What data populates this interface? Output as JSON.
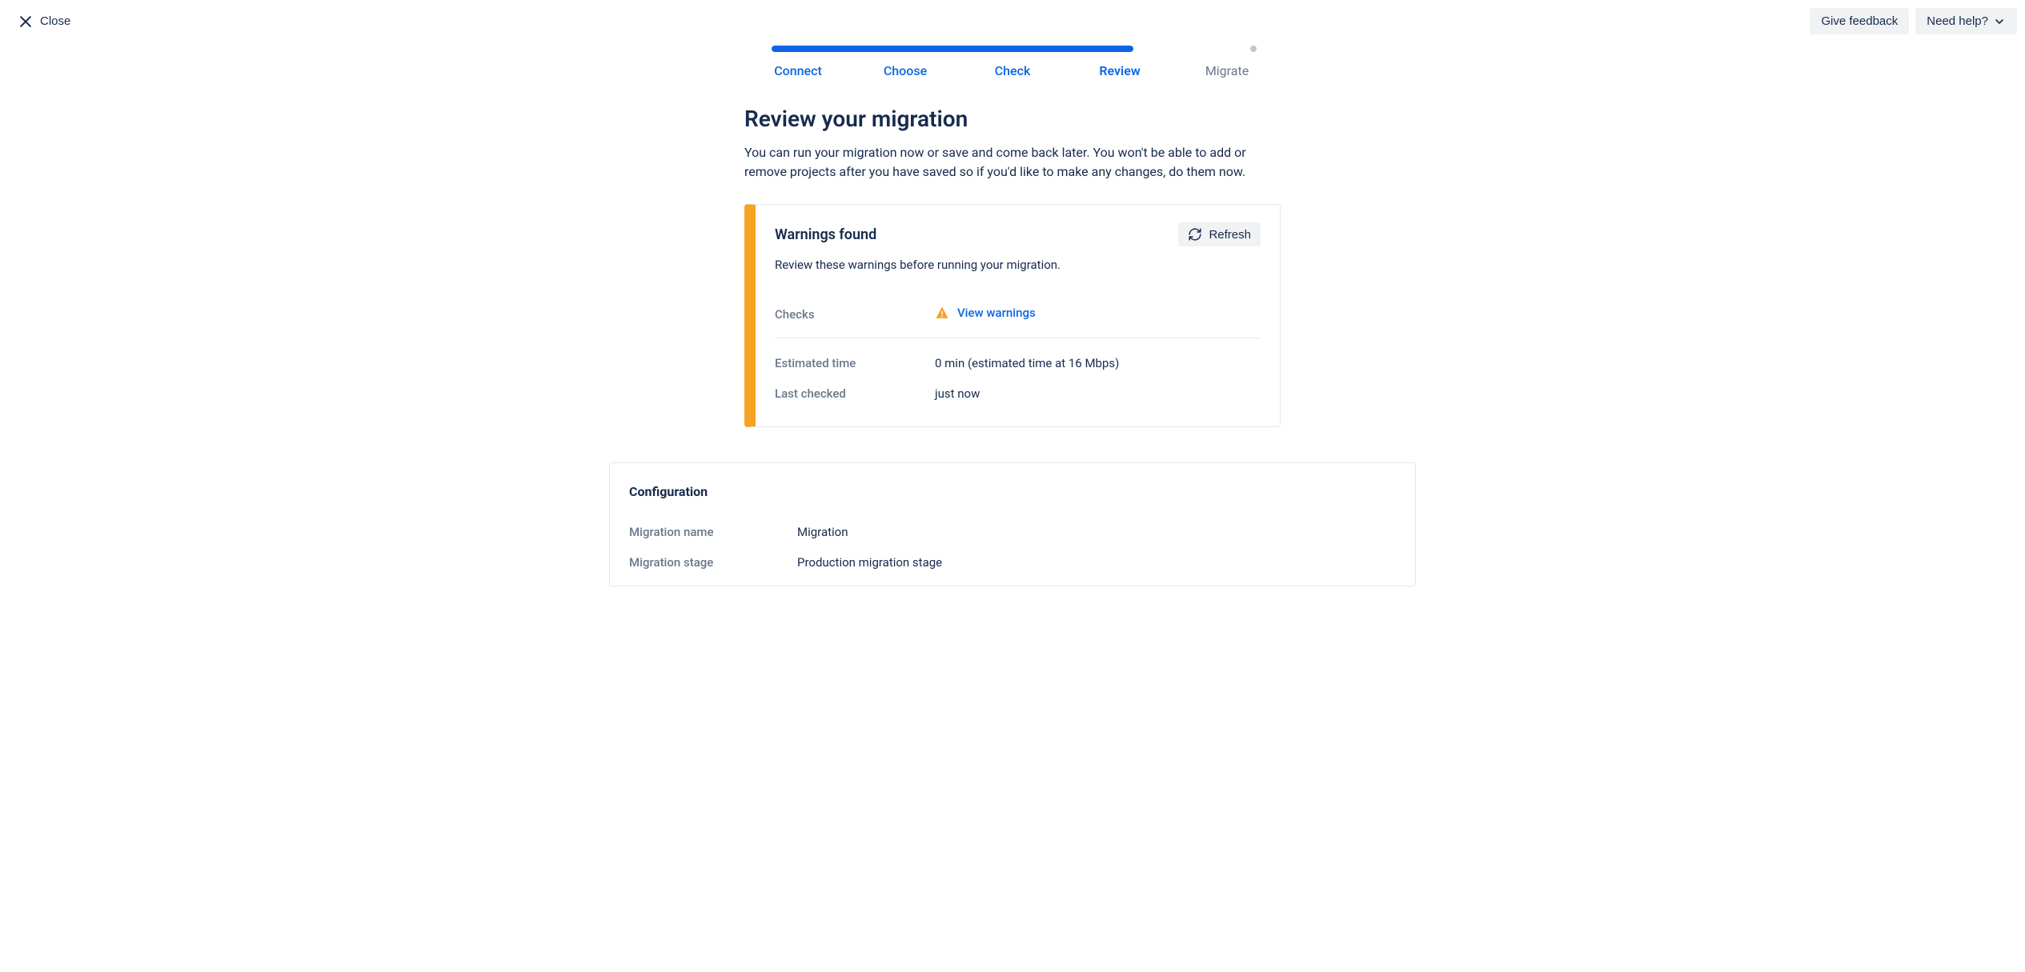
{
  "header": {
    "close_label": "Close",
    "give_feedback_label": "Give feedback",
    "need_help_label": "Need help?"
  },
  "stepper": {
    "steps": [
      {
        "label": "Connect",
        "state": "done"
      },
      {
        "label": "Choose",
        "state": "done"
      },
      {
        "label": "Check",
        "state": "done"
      },
      {
        "label": "Review",
        "state": "current"
      },
      {
        "label": "Migrate",
        "state": "next"
      }
    ]
  },
  "page": {
    "title": "Review your migration",
    "description": "You can run your migration now or save and come back later. You won't be able to add or remove projects after you have saved so if you'd like to make any changes, do them now."
  },
  "warnings": {
    "title": "Warnings found",
    "description": "Review these warnings before running your migration.",
    "refresh_label": "Refresh",
    "rows": {
      "checks_label": "Checks",
      "view_warnings_label": "View warnings",
      "estimated_time_label": "Estimated time",
      "estimated_time_value": "0 min (estimated time at 16 Mbps)",
      "last_checked_label": "Last checked",
      "last_checked_value": "just now"
    }
  },
  "configuration": {
    "title": "Configuration",
    "rows": [
      {
        "label": "Migration name",
        "value": "Migration"
      },
      {
        "label": "Migration stage",
        "value": "Production migration stage"
      }
    ]
  }
}
